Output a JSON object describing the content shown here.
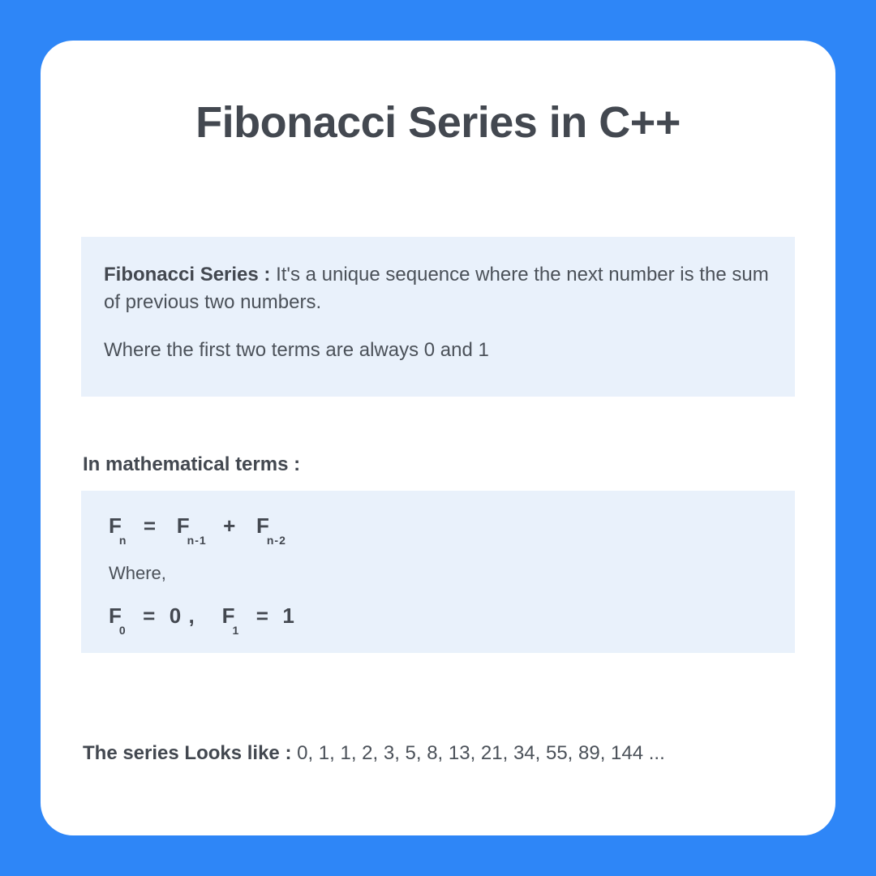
{
  "title": "Fibonacci Series in C++",
  "definition": {
    "term": "Fibonacci Series :",
    "text": " It's a unique sequence where the next number is the sum of previous two numbers.",
    "subtext": "Where the first two terms are always 0 and 1"
  },
  "math": {
    "heading": "In mathematical terms :",
    "f": "F",
    "sub_n": "n",
    "sub_n1": "n-1",
    "sub_n2": "n-2",
    "sub_0": "0",
    "sub_1": "1",
    "eq": "=",
    "plus": "+",
    "zero_comma": "0 ,",
    "one": "1",
    "where": "Where,"
  },
  "series": {
    "label": "The series Looks like :",
    "values": " 0, 1, 1, 2, 3, 5, 8, 13, 21, 34, 55, 89, 144 ..."
  }
}
